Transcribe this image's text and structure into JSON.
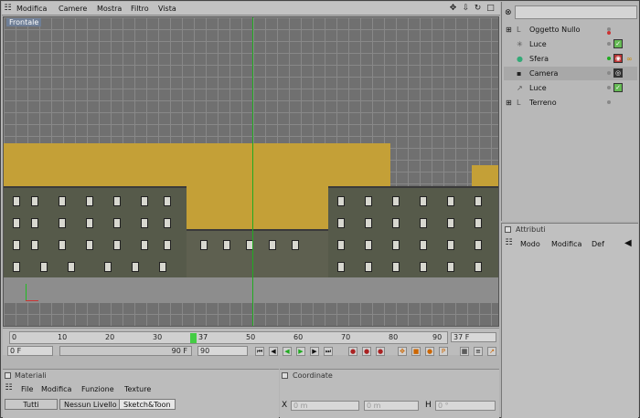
{
  "menu": [
    "Modifica",
    "Camere",
    "Mostra",
    "Filtro",
    "Vista"
  ],
  "viewport": {
    "label": "Frontale"
  },
  "timeline": {
    "ticks": [
      "0",
      "10",
      "20",
      "30",
      "40",
      "50",
      "60",
      "70",
      "80",
      "90"
    ],
    "current_frame": "37",
    "current_frame_box": "37 F",
    "start": "0 F",
    "end_left": "90 F",
    "end_right": "90"
  },
  "materials": {
    "title": "Materiali",
    "menu": [
      "File",
      "Modifica",
      "Funzione",
      "Texture"
    ],
    "tabs": [
      "Tutti",
      "Nessun Livello",
      "Sketch&Toon"
    ]
  },
  "coords": {
    "title": "Coordinate",
    "x_label": "X",
    "x_val1": "0 m",
    "x_val2": "0 m",
    "h_label": "H",
    "h_val": "0 °"
  },
  "objects": [
    {
      "name": "Oggetto Nullo",
      "icon": "null-icon"
    },
    {
      "name": "Luce",
      "icon": "light-icon"
    },
    {
      "name": "Sfera",
      "icon": "sphere-icon"
    },
    {
      "name": "Camera",
      "icon": "camera-icon"
    },
    {
      "name": "Luce",
      "icon": "light-icon"
    },
    {
      "name": "Terreno",
      "icon": "null-icon"
    }
  ],
  "attributes": {
    "title": "Attributi",
    "menu": [
      "Modo",
      "Modifica",
      "Def"
    ]
  }
}
